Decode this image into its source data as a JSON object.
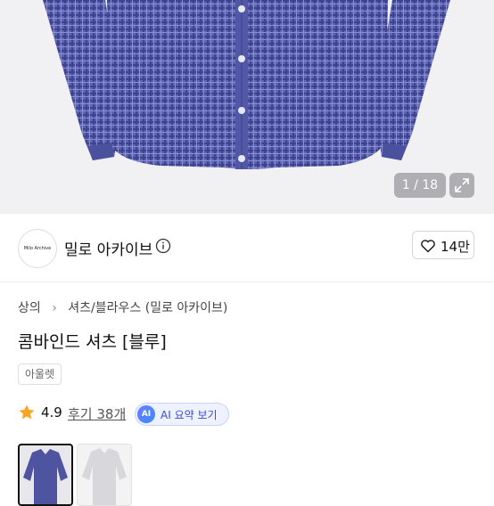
{
  "gallery": {
    "counter": "1 / 18",
    "shirt_color": "#5a5fae",
    "check_color": "#3c3f8a"
  },
  "store": {
    "logo_text": "Milo Archive",
    "name": "밀로 아카이브",
    "like_count": "14만"
  },
  "breadcrumb": [
    "상의",
    "셔츠/블라우스 (밀로 아카이브)"
  ],
  "product": {
    "title": "콤바인드 셔츠 [블루]",
    "tag": "아울렛",
    "rating": "4.9",
    "reviews": "후기 38개",
    "ai_button": "AI 요약 보기",
    "ai_badge": "AI"
  },
  "colors": {
    "star": "#f5a623",
    "accent": "#3a4bd6"
  }
}
